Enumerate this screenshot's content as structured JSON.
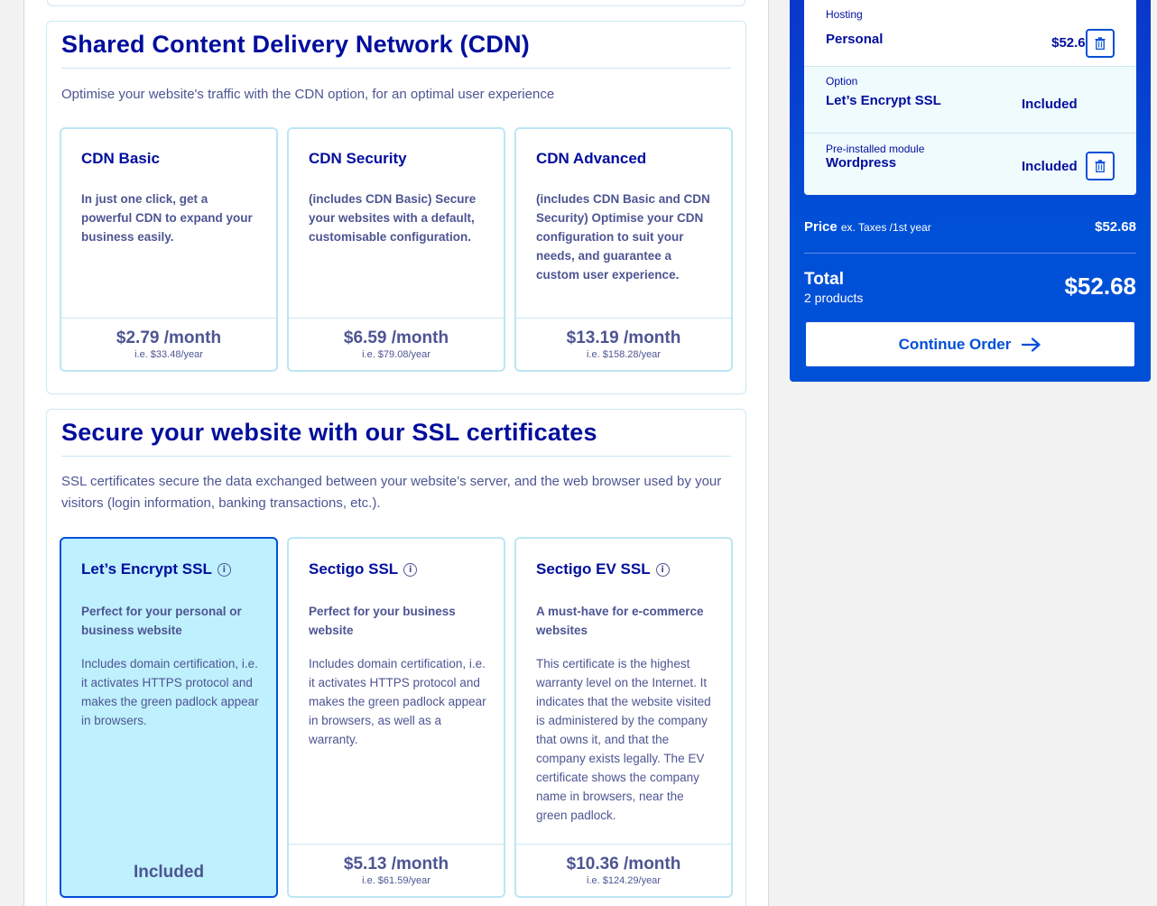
{
  "cdn_section": {
    "title": "Shared Content Delivery Network (CDN)",
    "description": "Optimise your website's traffic with the CDN option, for an optimal user experience",
    "cards": [
      {
        "title": "CDN Basic",
        "lead": "In just one click, get a powerful CDN to expand your business easily.",
        "price": "$2.79 /month",
        "price_sub": "i.e. $33.48/year"
      },
      {
        "title": "CDN Security",
        "lead": "(includes CDN Basic) Secure your websites with a default, customisable configuration.",
        "price": "$6.59 /month",
        "price_sub": "i.e. $79.08/year"
      },
      {
        "title": "CDN Advanced",
        "lead": "(includes CDN Basic and CDN Security) Optimise your CDN configuration to suit your needs, and guarantee a custom user experience.",
        "price": "$13.19 /month",
        "price_sub": "i.e. $158.28/year"
      }
    ]
  },
  "ssl_section": {
    "title": "Secure your website with our SSL certificates",
    "description": "SSL certificates secure the data exchanged between your website’s server, and the web browser used by your visitors (login information, banking transactions, etc.).",
    "cards": [
      {
        "title": "Let’s Encrypt SSL",
        "lead": "Perfect for your personal or business website",
        "body": "Includes domain certification, i.e. it activates HTTPS protocol and makes the green padlock appear in browsers.",
        "status": "Included"
      },
      {
        "title": "Sectigo SSL",
        "lead": "Perfect for your business website",
        "body": "Includes domain certification, i.e. it activates HTTPS protocol and makes the green padlock appear in browsers, as well as a warranty.",
        "price": "$5.13 /month",
        "price_sub": "i.e. $61.59/year"
      },
      {
        "title": "Sectigo EV SSL",
        "lead": "A must-have for e-commerce websites",
        "body": "This certificate is the highest warranty level on the Internet. It indicates that the website visited is administered by the company that owns it, and that the company exists legally. The EV certificate shows the company name in browsers, near the green padlock.",
        "price": "$10.36 /month",
        "price_sub": "i.e. $124.29/year"
      }
    ]
  },
  "cart": {
    "items": [
      {
        "category": "Hosting",
        "name": "Personal",
        "value": "$52.68"
      },
      {
        "category": "Option",
        "name": "Let’s Encrypt SSL",
        "value": "Included"
      },
      {
        "category": "Pre-installed module",
        "name": "Wordpress",
        "value": "Included"
      }
    ],
    "price_label": "Price",
    "price_note": "ex. Taxes /1st year",
    "price_value": "$52.68",
    "total_label": "Total",
    "total_count": "2 products",
    "total_value": "$52.68",
    "continue_label": "Continue Order"
  },
  "colors": {
    "primary": "#000e9c",
    "accent": "#0050d7",
    "selected_bg": "#bff0fd",
    "border": "#cce8f2",
    "muted_text": "#4d5592"
  }
}
